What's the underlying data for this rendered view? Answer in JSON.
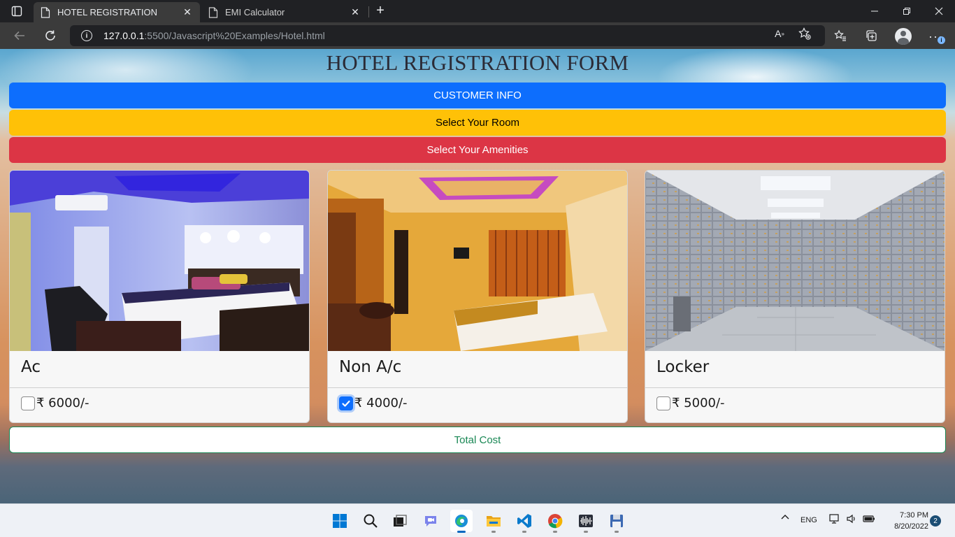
{
  "browser": {
    "tabs": [
      {
        "title": "HOTEL REGISTRATION",
        "active": true
      },
      {
        "title": "EMI Calculator",
        "active": false
      }
    ],
    "address": {
      "host": "127.0.0.1",
      "rest": ":5500/Javascript%20Examples/Hotel.html"
    },
    "notification_count_badge": "i"
  },
  "page": {
    "title": "HOTEL REGISTRATION FORM",
    "sections": {
      "customer_info": "CUSTOMER INFO",
      "select_room": "Select Your Room",
      "select_amenities": "Select Your Amenities"
    },
    "cards": [
      {
        "name": "Ac",
        "price": "₹ 6000/-",
        "checked": false,
        "image": "ac-room-photo"
      },
      {
        "name": "Non A/c",
        "price": "₹ 4000/-",
        "checked": true,
        "image": "non-ac-room-photo"
      },
      {
        "name": "Locker",
        "price": "₹ 5000/-",
        "checked": false,
        "image": "locker-vault-photo"
      }
    ],
    "total_button": "Total Cost",
    "colors": {
      "primary": "#0d6efd",
      "warning": "#ffc107",
      "danger": "#dc3545",
      "success": "#198754"
    }
  },
  "taskbar": {
    "apps": [
      "windows-start-icon",
      "search-icon",
      "task-view-icon",
      "teams-chat-icon",
      "edge-icon",
      "file-explorer-icon",
      "vscode-icon",
      "chrome-icon",
      "audio-editor-icon",
      "floppy-save-icon"
    ],
    "language": "ENG",
    "time": "7:30 PM",
    "date": "8/20/2022",
    "notifications": "2"
  }
}
